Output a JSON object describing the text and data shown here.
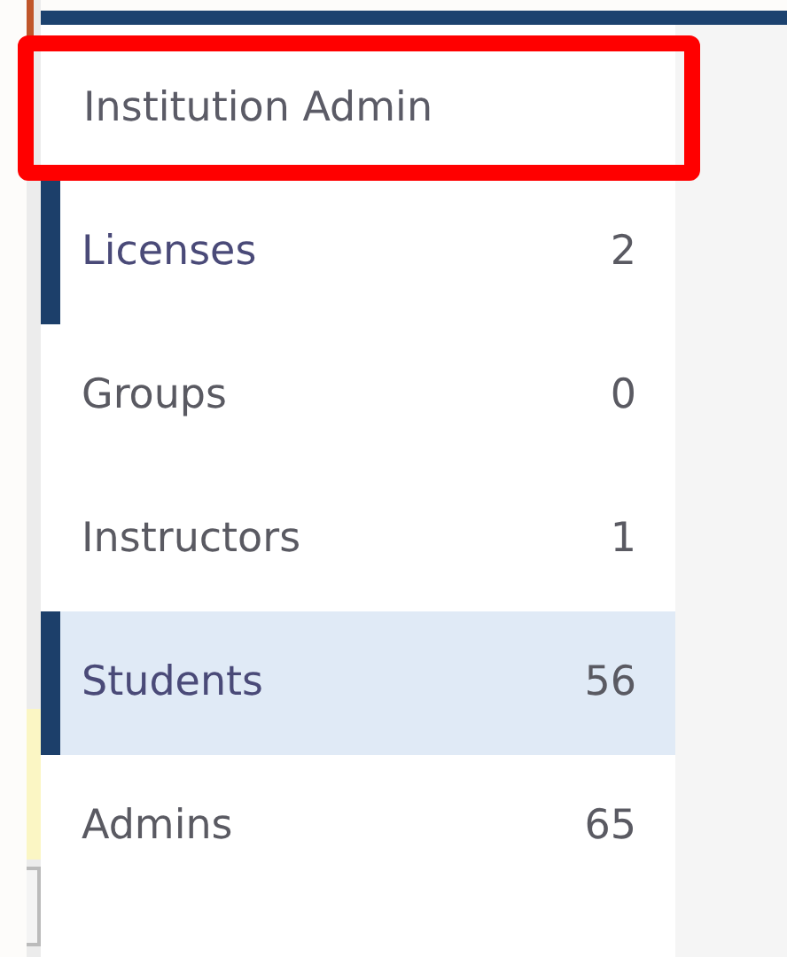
{
  "sidebar": {
    "title": "Institution Admin",
    "title_highlighted": true,
    "items": [
      {
        "label": "Licenses",
        "count": "2",
        "marked": true,
        "selected": false
      },
      {
        "label": "Groups",
        "count": "0",
        "marked": false,
        "selected": false
      },
      {
        "label": "Instructors",
        "count": "1",
        "marked": false,
        "selected": false
      },
      {
        "label": "Students",
        "count": "56",
        "marked": true,
        "selected": true
      },
      {
        "label": "Admins",
        "count": "65",
        "marked": false,
        "selected": false
      }
    ]
  }
}
